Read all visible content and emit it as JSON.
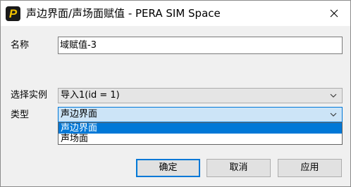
{
  "window": {
    "title": "声边界面/声场面赋值 - PERA SIM Space",
    "app_icon_letter": "P"
  },
  "form": {
    "name_label": "名称",
    "name_value": "域赋值-3",
    "instance_label": "选择实例",
    "instance_value": "导入1(id = 1)",
    "type_label": "类型",
    "type_value": "声边界面",
    "type_options": [
      "声边界面",
      "声场面"
    ],
    "type_selected_index": 0
  },
  "buttons": {
    "ok": "确定",
    "cancel": "取消",
    "apply": "应用"
  },
  "colors": {
    "accent": "#0078d7",
    "icon_bg": "#1a1a1a",
    "icon_fg": "#f2c200"
  }
}
